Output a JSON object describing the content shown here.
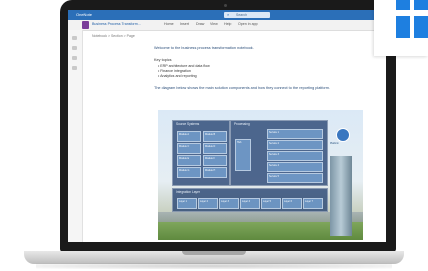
{
  "app": {
    "title": "OneNote",
    "search_placeholder": "Search"
  },
  "tabs": [
    "Business Process Transform...",
    "Home",
    "Insert",
    "Draw",
    "View",
    "Help",
    "Open in app"
  ],
  "breadcrumb": "Notebook  >  Section  >  Page",
  "note": {
    "intro_line": "Welcome to the business process transformation notebook.",
    "list_heading": "Key topics",
    "bullets": [
      "ERP architecture and data flow",
      "Finance integration",
      "Analytics and reporting"
    ],
    "footer_line": "The diagram below shows the main solution components and how they connect to the reporting platform."
  },
  "diagram": {
    "left_panel_title": "Source Systems",
    "mid_panel_title": "Processing",
    "bottom_panel_title": "Integration Layer",
    "logo_caption": "Platform",
    "left_cells": [
      "Module A",
      "Module B",
      "Module C",
      "Module D",
      "Module E",
      "Module F",
      "Module G",
      "Module H"
    ],
    "mid_cells": [
      "Hub"
    ],
    "right_cells": [
      "Service 1",
      "Service 2",
      "Service 3",
      "Service 4",
      "Service 5"
    ],
    "bottom_cells": [
      "Layer 1",
      "Layer 2",
      "Layer 3",
      "Layer 4",
      "Layer 5",
      "Layer 6",
      "Layer 7"
    ]
  },
  "colors": {
    "titlebar": "#2b6fb8",
    "windows_logo": "#1e7fe0",
    "panel": "#224070"
  }
}
